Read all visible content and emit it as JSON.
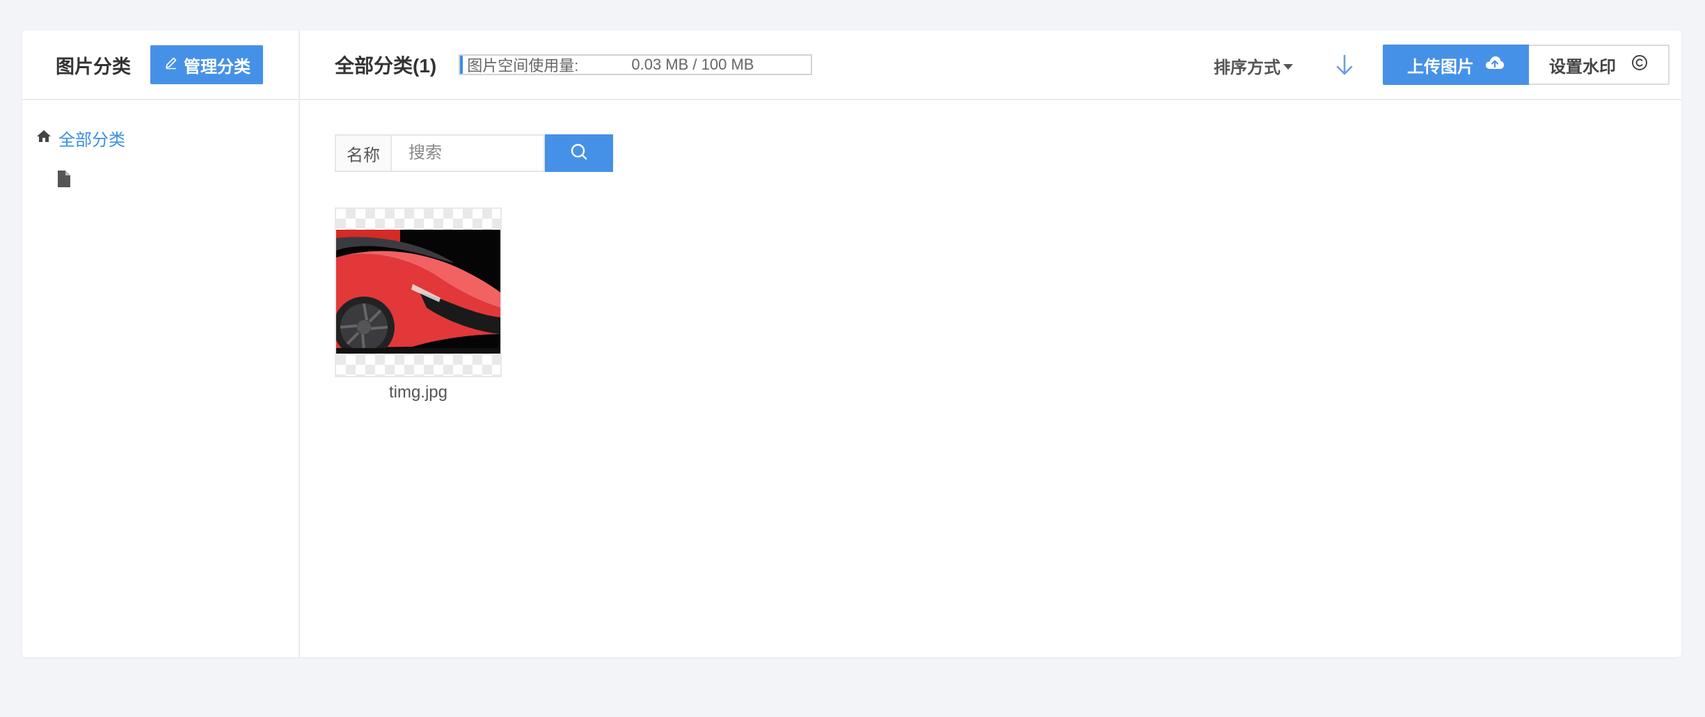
{
  "sidebar": {
    "title": "图片分类",
    "manage_button": "管理分类",
    "tree": [
      {
        "label": "全部分类",
        "icon": "home-icon",
        "active": true
      },
      {
        "label": "",
        "icon": "file-icon",
        "active": false
      }
    ]
  },
  "header": {
    "title": "全部分类(1)",
    "usage_label": "图片空间使用量:",
    "usage_value": "0.03 MB / 100 MB",
    "usage_fraction": 0.0003,
    "sort_label": "排序方式",
    "sort_direction_icon": "arrow-down-icon",
    "upload_button": "上传图片",
    "upload_icon": "cloud-upload-icon",
    "watermark_button": "设置水印",
    "watermark_icon": "copyright-icon"
  },
  "search": {
    "label": "名称",
    "placeholder": "搜索",
    "value": "",
    "button_icon": "search-icon"
  },
  "images": [
    {
      "name": "timg.jpg"
    }
  ],
  "colors": {
    "accent": "#4691e8",
    "link": "#3a8ee6",
    "background": "#f3f4f8"
  }
}
